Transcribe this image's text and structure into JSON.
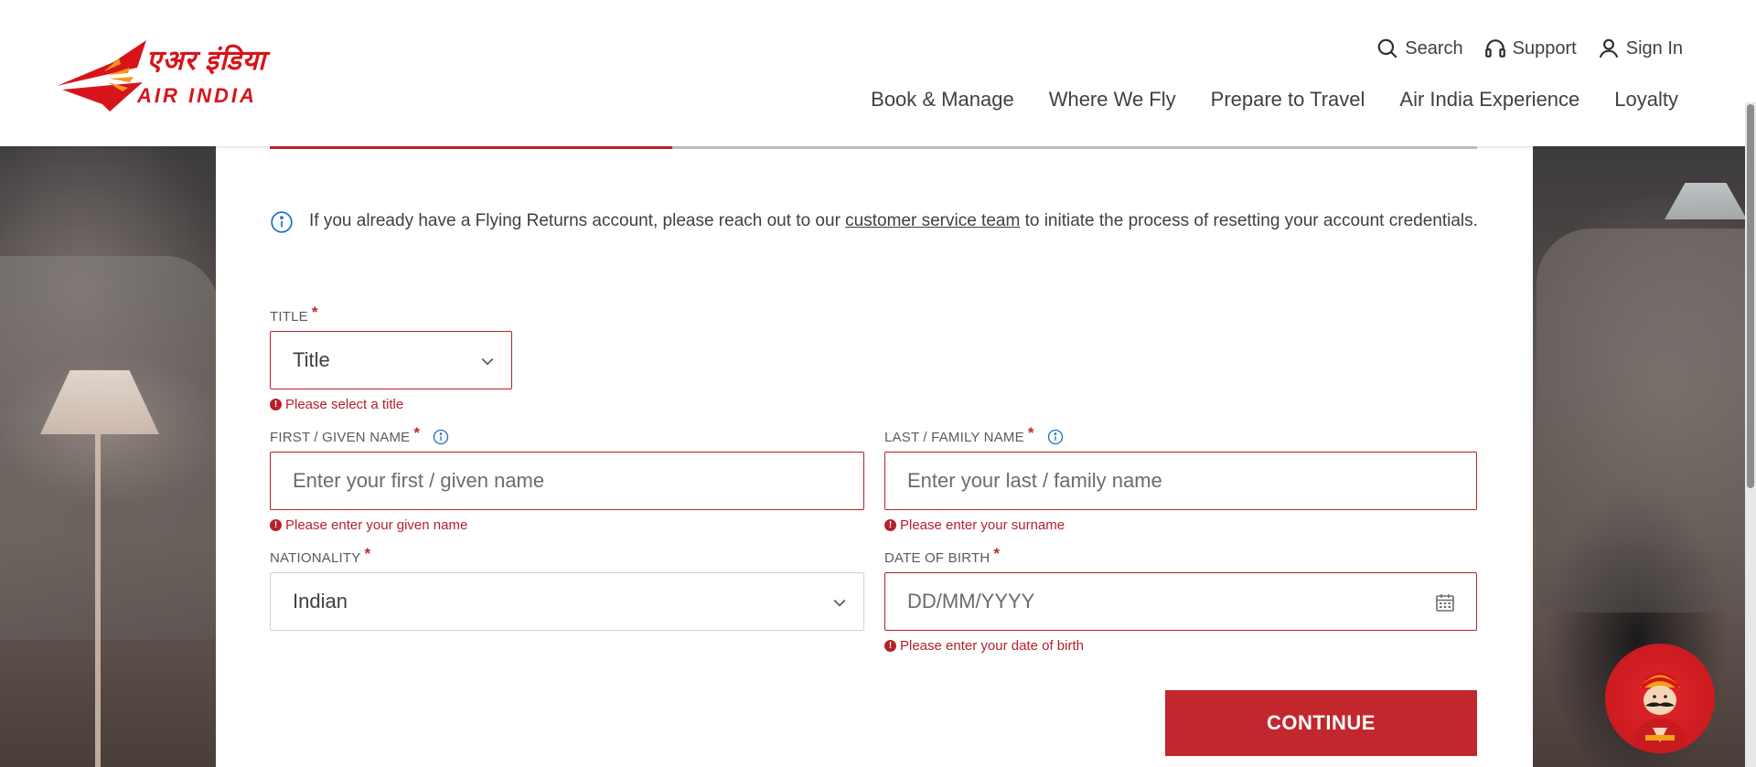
{
  "header": {
    "logo": {
      "hindi": "एअर इंडिया",
      "english": "AIR INDIA"
    },
    "util_nav": [
      {
        "label": "Search",
        "icon": "search-icon"
      },
      {
        "label": "Support",
        "icon": "headset-icon"
      },
      {
        "label": "Sign In",
        "icon": "user-icon"
      }
    ],
    "main_nav": [
      {
        "label": "Book & Manage"
      },
      {
        "label": "Where We Fly"
      },
      {
        "label": "Prepare to Travel"
      },
      {
        "label": "Air India Experience"
      },
      {
        "label": "Loyalty"
      }
    ]
  },
  "form": {
    "progress_fraction": 0.3333,
    "info": {
      "text_before": "If you already have a Flying Returns account, please reach out to our ",
      "link_text": "customer service team",
      "text_after": " to initiate the process of resetting your account credentials."
    },
    "title": {
      "label": "TITLE",
      "value": "Title",
      "error": "Please select a title"
    },
    "first_name": {
      "label": "FIRST / GIVEN NAME",
      "placeholder": "Enter your first / given name",
      "error": "Please enter your given name"
    },
    "last_name": {
      "label": "LAST / FAMILY NAME",
      "placeholder": "Enter your last / family name",
      "error": "Please enter your surname"
    },
    "nationality": {
      "label": "NATIONALITY",
      "value": "Indian"
    },
    "dob": {
      "label": "DATE OF BIRTH",
      "placeholder": "DD/MM/YYYY",
      "error": "Please enter your date of birth"
    },
    "required_marker": "*",
    "continue_label": "CONTINUE"
  },
  "colors": {
    "accent": "#c2272d",
    "error": "#b7202a",
    "info_blue": "#1a73c8",
    "text": "#3f3f46"
  }
}
